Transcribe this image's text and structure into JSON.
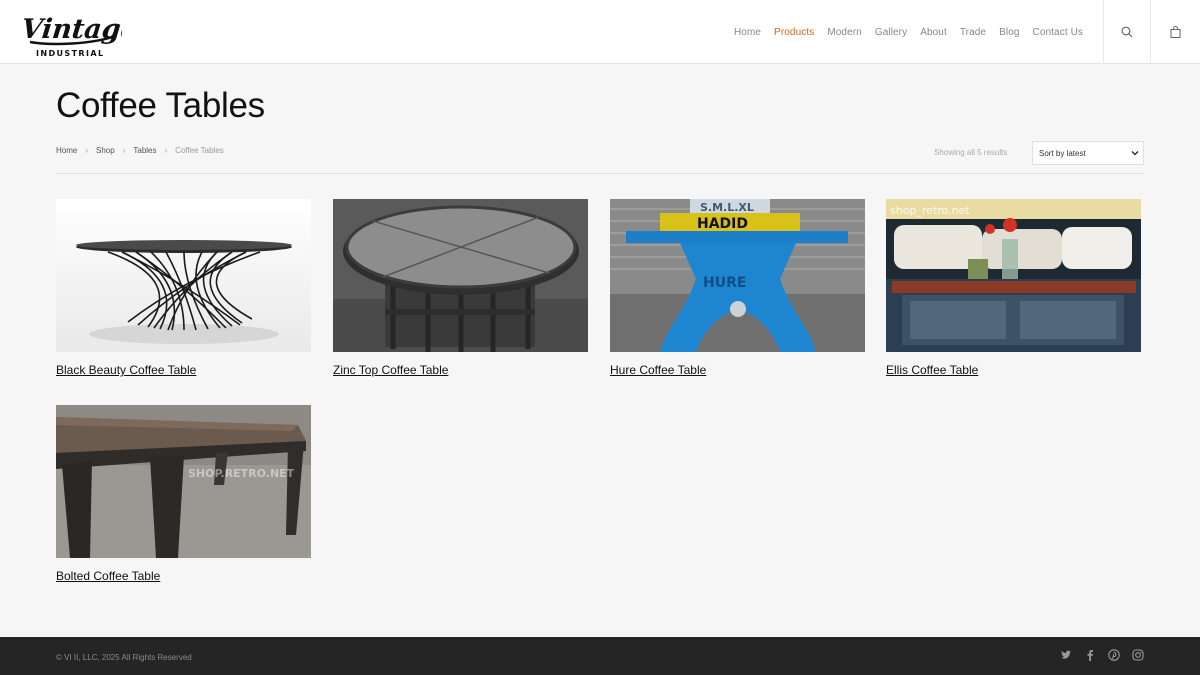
{
  "brand": {
    "logo_text": "Vintage",
    "logo_subtext": "INDUSTRIAL"
  },
  "nav": {
    "items": [
      {
        "label": "Home",
        "active": false
      },
      {
        "label": "Products",
        "active": true
      },
      {
        "label": "Modern",
        "active": false
      },
      {
        "label": "Gallery",
        "active": false
      },
      {
        "label": "About",
        "active": false
      },
      {
        "label": "Trade",
        "active": false
      },
      {
        "label": "Blog",
        "active": false
      },
      {
        "label": "Contact Us",
        "active": false
      }
    ],
    "accent_color": "#d2691e"
  },
  "icons": {
    "search": "search-icon",
    "cart": "shopping-bag-icon"
  },
  "page": {
    "title": "Coffee Tables"
  },
  "breadcrumb": {
    "items": [
      "Home",
      "Shop",
      "Tables"
    ],
    "current": "Coffee Tables"
  },
  "shop": {
    "result_count": "Showing all 5 results",
    "sort_selected": "Sort by latest"
  },
  "products": [
    {
      "name": "Black Beauty Coffee Table"
    },
    {
      "name": "Zinc Top Coffee Table"
    },
    {
      "name": "Hure Coffee Table",
      "image_text": [
        "S.M.L.XL",
        "HADID",
        "HURE"
      ]
    },
    {
      "name": "Ellis Coffee Table",
      "image_text": [
        "shop_retro.net"
      ]
    },
    {
      "name": "Bolted Coffee Table",
      "image_text": [
        "SHOP.RETRO.NET"
      ]
    }
  ],
  "footer": {
    "copyright": "© VI II, LLC, 2025 All Rights Reserved",
    "socials": [
      "twitter-icon",
      "facebook-icon",
      "pinterest-icon",
      "instagram-icon"
    ]
  }
}
